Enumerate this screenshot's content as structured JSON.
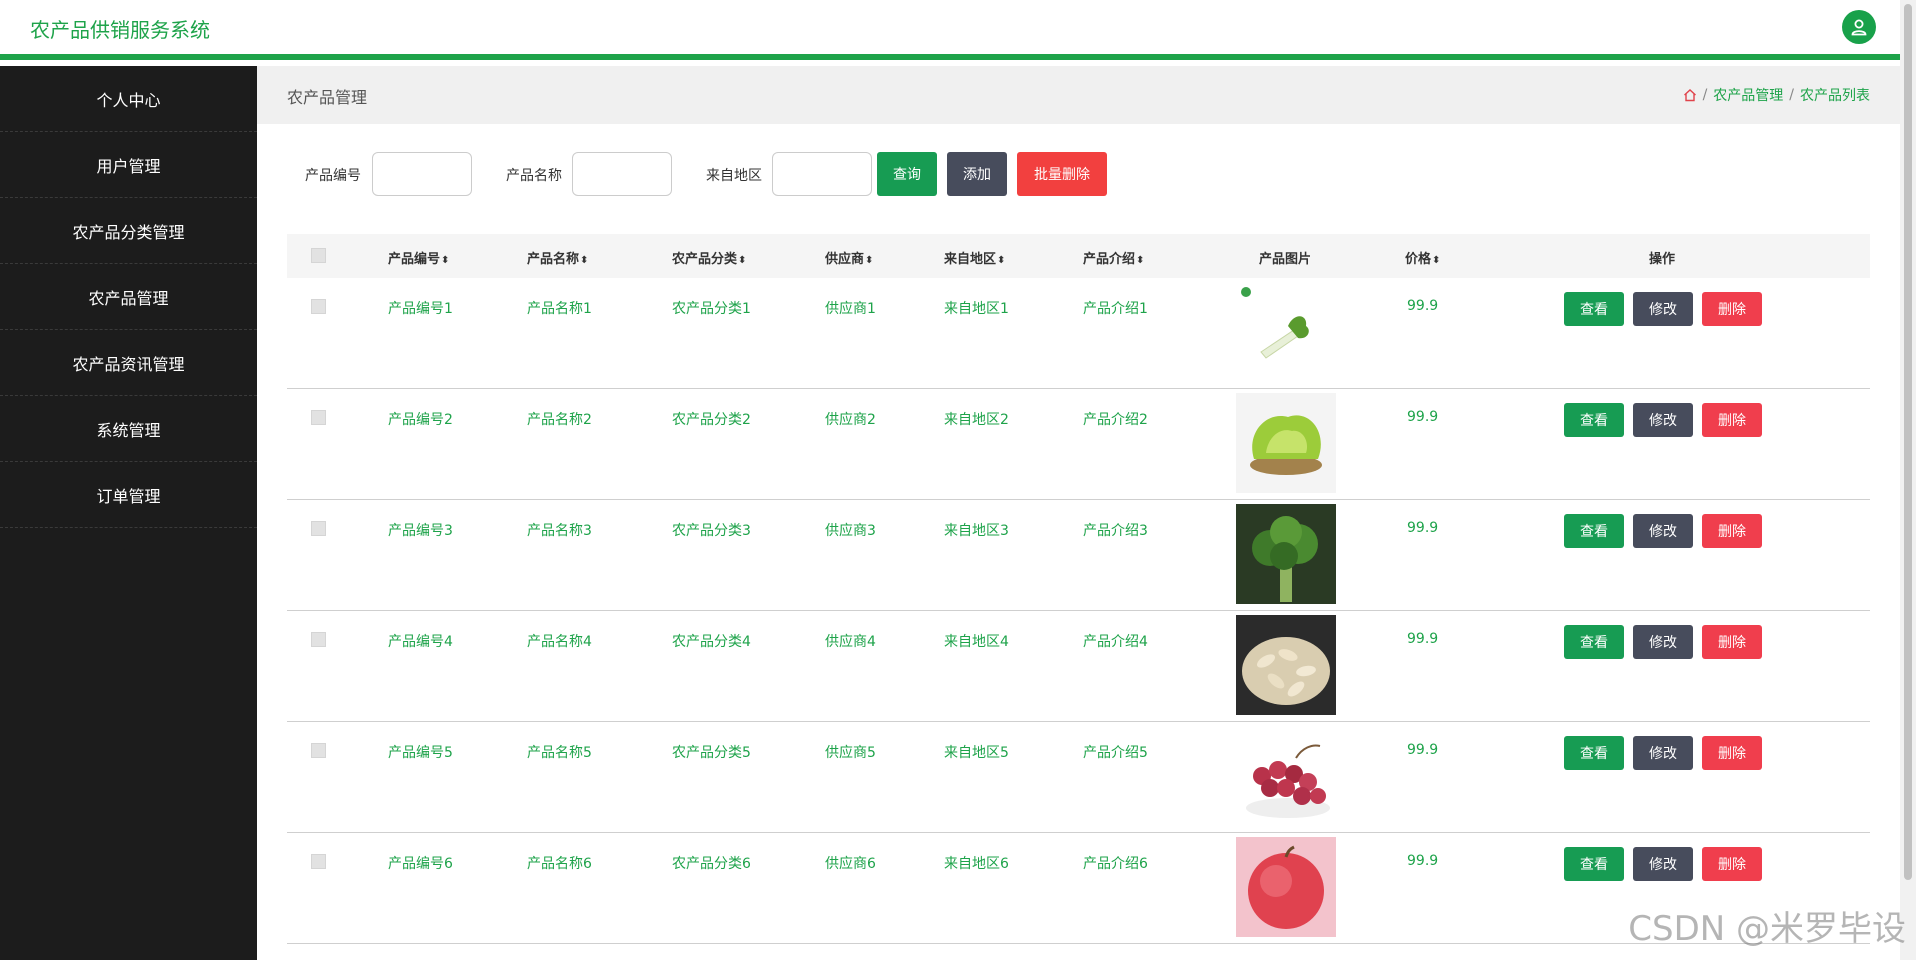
{
  "header": {
    "title": "农产品供销服务系统",
    "avatar_icon": "user-icon",
    "accent": "#1ea34a"
  },
  "sidebar": {
    "items": [
      {
        "label": "个人中心"
      },
      {
        "label": "用户管理"
      },
      {
        "label": "农产品分类管理"
      },
      {
        "label": "农产品管理"
      },
      {
        "label": "农产品资讯管理"
      },
      {
        "label": "系统管理"
      },
      {
        "label": "订单管理"
      }
    ]
  },
  "breadcrumb": {
    "title": "农产品管理",
    "home_icon": "home-icon",
    "items": [
      "农产品管理",
      "农产品列表"
    ],
    "separator": "/"
  },
  "search": {
    "fields": [
      {
        "label": "产品编号",
        "value": ""
      },
      {
        "label": "产品名称",
        "value": ""
      },
      {
        "label": "来自地区",
        "value": ""
      }
    ],
    "query_label": "查询",
    "add_label": "添加",
    "batch_delete_label": "批量删除"
  },
  "table": {
    "columns": [
      "产品编号",
      "产品名称",
      "农产品分类",
      "供应商",
      "来自地区",
      "产品介绍",
      "产品图片",
      "价格",
      "操作"
    ],
    "rows": [
      {
        "code": "产品编号1",
        "name": "产品名称1",
        "category": "农产品分类1",
        "supplier": "供应商1",
        "region": "来自地区1",
        "intro": "产品介绍1",
        "image": "celery",
        "price": "99.9"
      },
      {
        "code": "产品编号2",
        "name": "产品名称2",
        "category": "农产品分类2",
        "supplier": "供应商2",
        "region": "来自地区2",
        "intro": "产品介绍2",
        "image": "lettuce",
        "price": "99.9"
      },
      {
        "code": "产品编号3",
        "name": "产品名称3",
        "category": "农产品分类3",
        "supplier": "供应商3",
        "region": "来自地区3",
        "intro": "产品介绍3",
        "image": "broccoli",
        "price": "99.9"
      },
      {
        "code": "产品编号4",
        "name": "产品名称4",
        "category": "农产品分类4",
        "supplier": "供应商4",
        "region": "来自地区4",
        "intro": "产品介绍4",
        "image": "seeds",
        "price": "99.9"
      },
      {
        "code": "产品编号5",
        "name": "产品名称5",
        "category": "农产品分类5",
        "supplier": "供应商5",
        "region": "来自地区5",
        "intro": "产品介绍5",
        "image": "grapes",
        "price": "99.9"
      },
      {
        "code": "产品编号6",
        "name": "产品名称6",
        "category": "农产品分类6",
        "supplier": "供应商6",
        "region": "来自地区6",
        "intro": "产品介绍6",
        "image": "apple",
        "price": "99.9"
      }
    ],
    "actions": {
      "view": "查看",
      "edit": "修改",
      "delete": "删除"
    }
  },
  "watermark": "CSDN @米罗毕设"
}
